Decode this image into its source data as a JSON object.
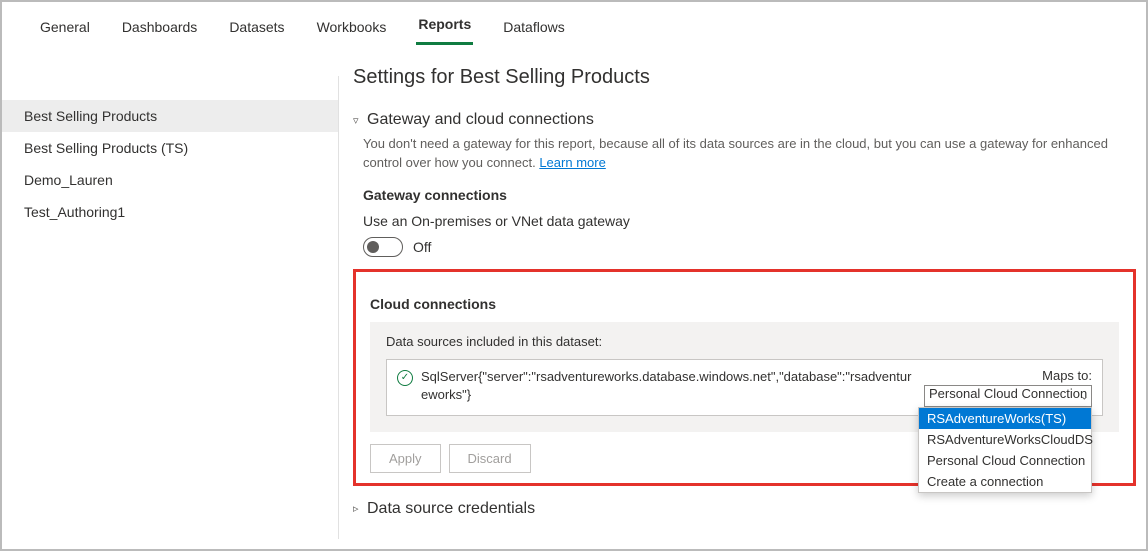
{
  "tabs": {
    "items": [
      "General",
      "Dashboards",
      "Datasets",
      "Workbooks",
      "Reports",
      "Dataflows"
    ],
    "active_index": 4
  },
  "sidebar": {
    "items": [
      "Best Selling Products",
      "Best Selling Products (TS)",
      "Demo_Lauren",
      "Test_Authoring1"
    ],
    "active_index": 0
  },
  "page_title": "Settings for Best Selling Products",
  "gateway_section": {
    "title": "Gateway and cloud connections",
    "description": "You don't need a gateway for this report, because all of its data sources are in the cloud, but you can use a gateway for enhanced control over how you connect. ",
    "learn_more": "Learn more",
    "gateway_header": "Gateway connections",
    "gateway_hint": "Use an On-premises or VNet data gateway",
    "toggle_state": "Off",
    "cloud_header": "Cloud connections",
    "panel_hint": "Data sources included in this dataset:",
    "datasource_text": "SqlServer{\"server\":\"rsadventureworks.database.windows.net\",\"database\":\"rsadventureworks\"}",
    "maps_label": "Maps to:",
    "selected_value": "Personal Cloud Connection",
    "options": [
      "RSAdventureWorks(TS)",
      "RSAdventureWorksCloudDS",
      "Personal Cloud Connection",
      "Create a connection"
    ],
    "highlighted_option_index": 0,
    "apply": "Apply",
    "discard": "Discard"
  },
  "creds_section": {
    "title": "Data source credentials"
  }
}
